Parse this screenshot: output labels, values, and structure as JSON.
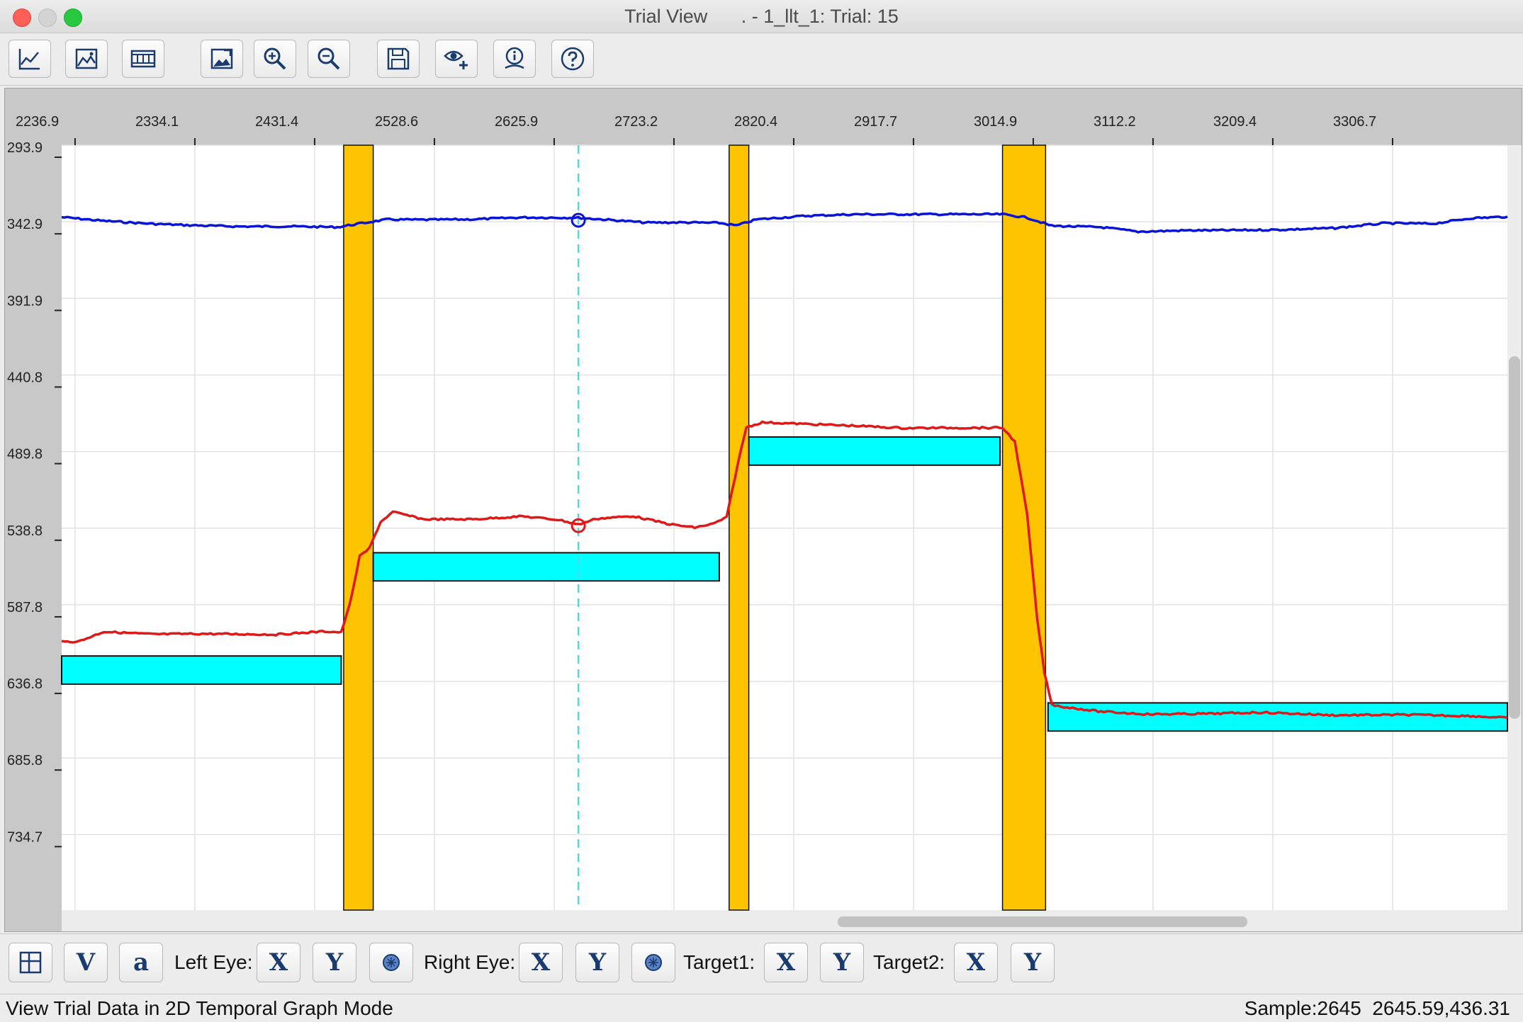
{
  "window": {
    "title_left": "Trial View",
    "title_right": ". - 1_llt_1: Trial: 15"
  },
  "toolbar": {
    "icons": [
      "line-graph-icon",
      "image-graph-icon",
      "film-strip-icon",
      "image-edit-icon",
      "zoom-in-icon",
      "zoom-out-icon",
      "save-icon",
      "eye-add-icon",
      "info-icon",
      "help-icon"
    ]
  },
  "chart_data": {
    "type": "line",
    "x_ticks": [
      "2236.9",
      "2334.1",
      "2431.4",
      "2528.6",
      "2625.9",
      "2723.2",
      "2820.4",
      "2917.7",
      "3014.9",
      "3112.2",
      "3209.4",
      "3306.7"
    ],
    "y_ticks": [
      "293.9",
      "342.9",
      "391.9",
      "440.8",
      "489.8",
      "538.8",
      "587.8",
      "636.8",
      "685.8",
      "734.7"
    ],
    "x_range": [
      2226.0,
      3400.0
    ],
    "y_range": [
      293.9,
      783.0
    ],
    "y_inverted": true,
    "cursor_x": 2645.59,
    "saccade_bands": [
      {
        "x0": 2455,
        "x1": 2479
      },
      {
        "x0": 2768,
        "x1": 2784
      },
      {
        "x0": 2990,
        "x1": 3025
      }
    ],
    "target_boxes": [
      {
        "x0": 2226,
        "x1": 2453,
        "y0": 620.5,
        "y1": 638.5
      },
      {
        "x0": 2479,
        "x1": 2760,
        "y0": 554.5,
        "y1": 572.5
      },
      {
        "x0": 2784,
        "x1": 2988,
        "y0": 480.5,
        "y1": 498.5
      },
      {
        "x0": 3027,
        "x1": 3400,
        "y0": 650.5,
        "y1": 668.5
      }
    ],
    "series": [
      {
        "color": "#0a14d8",
        "points": [
          [
            2226,
            339.9
          ],
          [
            2260,
            342.3
          ],
          [
            2300,
            344.2
          ],
          [
            2330,
            345.1
          ],
          [
            2370,
            345.9
          ],
          [
            2410,
            345.8
          ],
          [
            2450,
            346.3
          ],
          [
            2470,
            343.8
          ],
          [
            2490,
            341.4
          ],
          [
            2520,
            341.6
          ],
          [
            2560,
            341.3
          ],
          [
            2600,
            340.1
          ],
          [
            2645.6,
            340.3
          ],
          [
            2670,
            341.6
          ],
          [
            2700,
            343.4
          ],
          [
            2730,
            343.3
          ],
          [
            2760,
            343.6
          ],
          [
            2774,
            345.3
          ],
          [
            2790,
            341.4
          ],
          [
            2830,
            339.1
          ],
          [
            2870,
            338.1
          ],
          [
            2910,
            338.1
          ],
          [
            2950,
            338.1
          ],
          [
            2990,
            338.1
          ],
          [
            3010,
            340.2
          ],
          [
            3030,
            345.5
          ],
          [
            3070,
            346.3
          ],
          [
            3100,
            349.2
          ],
          [
            3140,
            348.4
          ],
          [
            3180,
            348.3
          ],
          [
            3220,
            347.9
          ],
          [
            3260,
            346.9
          ],
          [
            3300,
            343.8
          ],
          [
            3340,
            344.1
          ],
          [
            3370,
            340.6
          ],
          [
            3400,
            339.6
          ]
        ]
      },
      {
        "color": "#e01818",
        "points": [
          [
            2226,
            611.5
          ],
          [
            2240,
            611.2
          ],
          [
            2260,
            605.0
          ],
          [
            2300,
            606.6
          ],
          [
            2340,
            606.3
          ],
          [
            2400,
            606.8
          ],
          [
            2440,
            604.8
          ],
          [
            2453,
            605.4
          ],
          [
            2460,
            587.4
          ],
          [
            2468,
            556.9
          ],
          [
            2476,
            551.5
          ],
          [
            2485,
            534.8
          ],
          [
            2495,
            528.4
          ],
          [
            2520,
            533.1
          ],
          [
            2560,
            533.1
          ],
          [
            2600,
            531.2
          ],
          [
            2630,
            533.5
          ],
          [
            2645.6,
            536.5
          ],
          [
            2660,
            532.7
          ],
          [
            2690,
            531.1
          ],
          [
            2720,
            536.3
          ],
          [
            2740,
            538.4
          ],
          [
            2755,
            536.0
          ],
          [
            2766,
            531.9
          ],
          [
            2775,
            497.8
          ],
          [
            2782,
            474.2
          ],
          [
            2795,
            471.1
          ],
          [
            2830,
            472.2
          ],
          [
            2870,
            473.3
          ],
          [
            2910,
            474.8
          ],
          [
            2950,
            474.6
          ],
          [
            2990,
            474.6
          ],
          [
            3000,
            483.4
          ],
          [
            3010,
            530.2
          ],
          [
            3018,
            595.9
          ],
          [
            3024,
            631.0
          ],
          [
            3030,
            651.6
          ],
          [
            3040,
            653.1
          ],
          [
            3070,
            656.1
          ],
          [
            3110,
            657.8
          ],
          [
            3160,
            657.4
          ],
          [
            3200,
            656.6
          ],
          [
            3260,
            658.4
          ],
          [
            3320,
            658.1
          ],
          [
            3370,
            658.9
          ],
          [
            3400,
            660.1
          ]
        ]
      }
    ],
    "markers": [
      {
        "x": 2645.6,
        "y": 341.9,
        "color": "#0a14d8"
      },
      {
        "x": 2645.6,
        "y": 537.2,
        "color": "#e01818"
      }
    ]
  },
  "bottom": {
    "v_label": "V",
    "a_label": "a",
    "left_eye_label": "Left Eye:",
    "right_eye_label": "Right Eye:",
    "target1_label": "Target1:",
    "target2_label": "Target2:",
    "x_label": "X",
    "y_label": "Y"
  },
  "status": {
    "mode_text": "View Trial Data in 2D Temporal Graph Mode",
    "sample_text": "Sample:2645  2645.59,436.31"
  }
}
